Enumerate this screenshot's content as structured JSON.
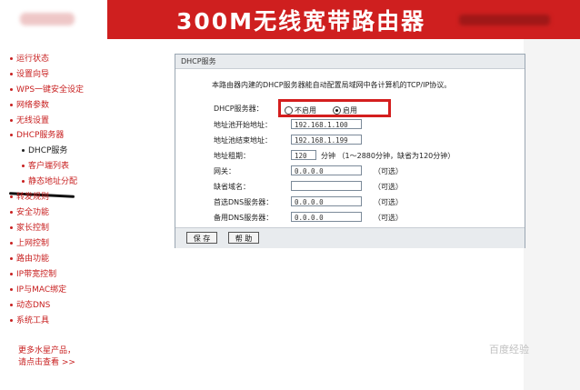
{
  "header": {
    "title": "300M无线宽带路由器"
  },
  "sidebar": {
    "items": [
      {
        "label": "运行状态"
      },
      {
        "label": "设置向导"
      },
      {
        "label": "WPS一键安全设定"
      },
      {
        "label": "网络参数"
      },
      {
        "label": "无线设置"
      },
      {
        "label": "DHCP服务器"
      },
      {
        "label": "DHCP服务"
      },
      {
        "label": "客户端列表"
      },
      {
        "label": "静态地址分配"
      },
      {
        "label": "转发规则"
      },
      {
        "label": "安全功能"
      },
      {
        "label": "家长控制"
      },
      {
        "label": "上网控制"
      },
      {
        "label": "路由功能"
      },
      {
        "label": "IP带宽控制"
      },
      {
        "label": "IP与MAC绑定"
      },
      {
        "label": "动态DNS"
      },
      {
        "label": "系统工具"
      }
    ],
    "more_line1": "更多水星产品，",
    "more_line2": "请点击查看 >>"
  },
  "panel": {
    "title": "DHCP服务",
    "description": "本路由器内建的DHCP服务器能自动配置局域网中各计算机的TCP/IP协议。",
    "dhcp_server_label": "DHCP服务器：",
    "radio_off": "不启用",
    "radio_on": "启用",
    "radio_selected": "启用",
    "start_ip_label": "地址池开始地址：",
    "start_ip_value": "192.168.1.100",
    "end_ip_label": "地址池结束地址：",
    "end_ip_value": "192.168.1.199",
    "lease_label": "地址租期：",
    "lease_value": "120",
    "lease_note": "分钟 （1～2880分钟，缺省为120分钟）",
    "gateway_label": "网关：",
    "gateway_value": "0.0.0.0",
    "domain_label": "缺省域名：",
    "domain_value": "",
    "dns1_label": "首选DNS服务器：",
    "dns1_value": "0.0.0.0",
    "dns2_label": "备用DNS服务器：",
    "dns2_value": "0.0.0.0",
    "optional": "（可选）",
    "save_label": "保 存",
    "help_label": "帮 助"
  },
  "watermark": "百度经验",
  "colors": {
    "brand_red": "#cf1f1f",
    "highlight_red": "#d41e1e"
  }
}
